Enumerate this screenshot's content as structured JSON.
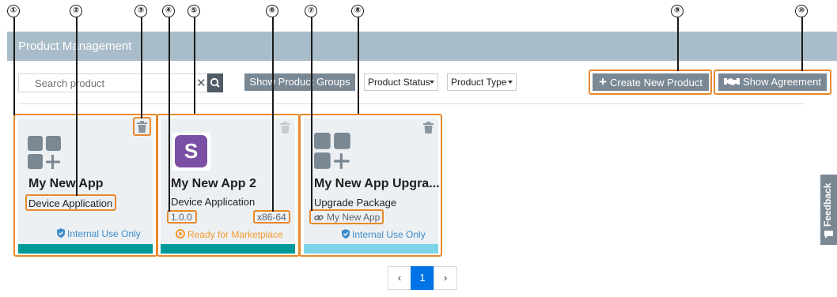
{
  "callouts": [
    "①",
    "②",
    "③",
    "④",
    "⑤",
    "⑥",
    "⑦",
    "⑧",
    "⑨",
    "⑩"
  ],
  "header": {
    "title": "Product Management"
  },
  "toolbar": {
    "search_placeholder": "Search product",
    "clear_glyph": "✕",
    "show_groups_label": "Show Product Groups",
    "status_filter_label": "Product Status",
    "type_filter_label": "Product Type",
    "create_label": "Create New Product",
    "create_glyph": "+",
    "agreement_label": "Show Agreement"
  },
  "cards": [
    {
      "title": "My New App",
      "type": "Device Application",
      "visibility": "Internal Use Only",
      "bar_color": "#009999"
    },
    {
      "title": "My New App 2",
      "type": "Device Application",
      "version": "1.0.0",
      "arch": "x86-64",
      "status": "Ready for Marketplace",
      "logo_letter": "S",
      "logo_color": "#7b4fa3",
      "bar_color": "#009999",
      "status_color": "#f39c2e"
    },
    {
      "title": "My New App Upgra...",
      "type": "Upgrade Package",
      "linked_app": "My New App",
      "visibility": "Internal Use Only",
      "bar_color": "#7dd3e8"
    }
  ],
  "colors": {
    "visibility": "#3c8bc7",
    "highlight": "#e8892c",
    "pager_active": "#0073e6"
  },
  "feedback": {
    "label": "Feedback"
  },
  "pagination": {
    "prev": "‹",
    "current": "1",
    "next": "›"
  }
}
